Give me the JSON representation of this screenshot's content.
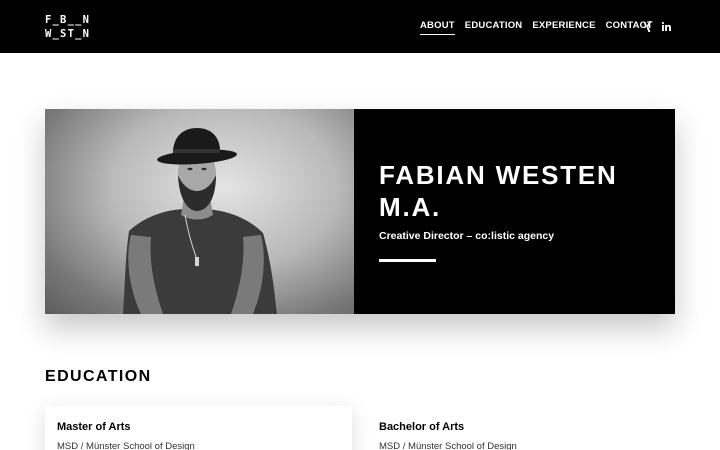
{
  "header": {
    "logo_line1": "F_B__N",
    "logo_line2": "W_ST_N",
    "nav": [
      "ABOUT",
      "EDUCATION",
      "EXPERIENCE",
      "CONTACT"
    ],
    "active_nav": "ABOUT",
    "social_icons": [
      "xing-icon",
      "linkedin-icon"
    ],
    "background_color": "#000000"
  },
  "hero": {
    "name_line1": "FABIAN WESTEN",
    "name_line2": "M.A.",
    "role": "Creative Director – co:listic agency",
    "photo": "black-and-white portrait of man in hat"
  },
  "education": {
    "title": "EDUCATION",
    "items": [
      {
        "degree": "Master of Arts",
        "school": "MSD / Münster School of Design"
      },
      {
        "degree": "Bachelor of Arts",
        "school": "MSD / Münster School of Design"
      }
    ]
  }
}
